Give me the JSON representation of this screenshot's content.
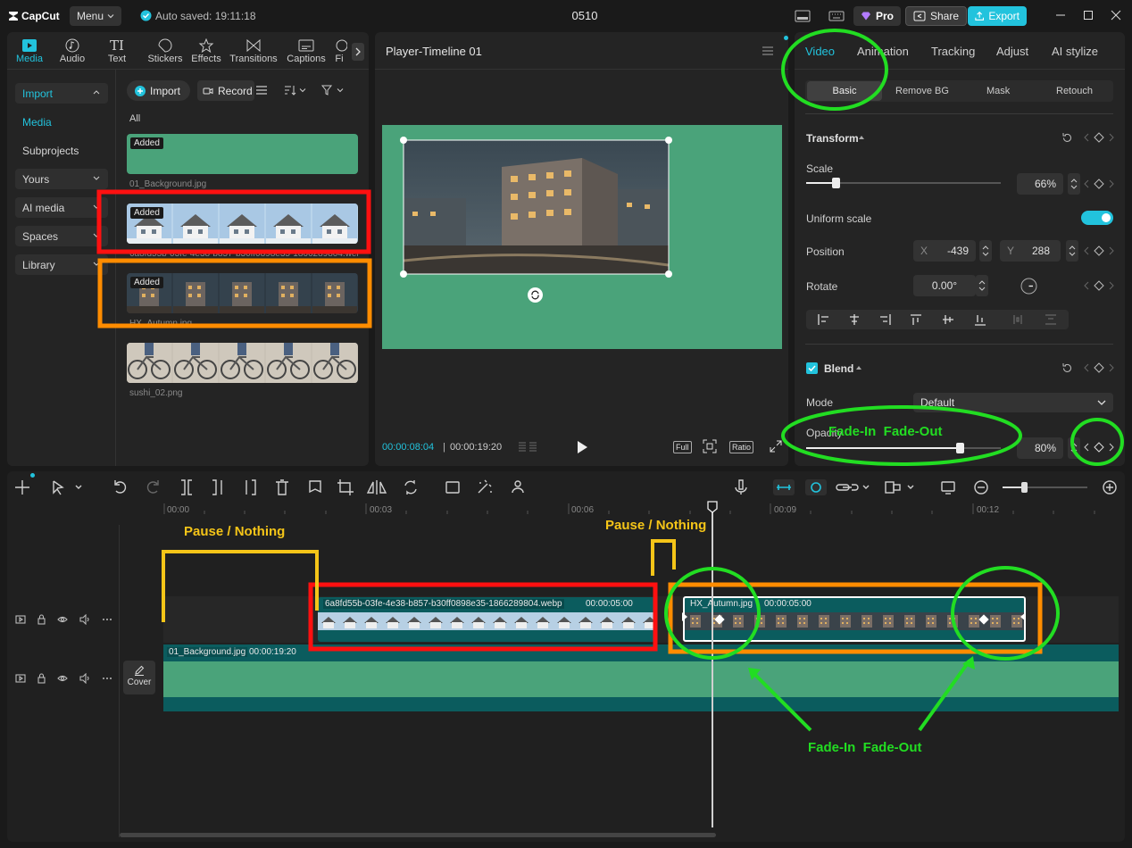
{
  "titlebar": {
    "logo": "CapCut",
    "menu_label": "Menu",
    "autosave": "Auto saved: 19:11:18",
    "project_name": "0510",
    "pro_label": "Pro",
    "share_label": "Share",
    "export_label": "Export"
  },
  "media_tabs": [
    {
      "label": "Media",
      "icon": "media-icon"
    },
    {
      "label": "Audio",
      "icon": "audio-icon"
    },
    {
      "label": "Text",
      "icon": "text-icon"
    },
    {
      "label": "Stickers",
      "icon": "stickers-icon"
    },
    {
      "label": "Effects",
      "icon": "effects-icon"
    },
    {
      "label": "Transitions",
      "icon": "transitions-icon"
    },
    {
      "label": "Captions",
      "icon": "captions-icon"
    },
    {
      "label": "Fi",
      "icon": "filters-icon"
    }
  ],
  "sidebar": {
    "import": "Import",
    "media": "Media",
    "subprojects": "Subprojects",
    "yours": "Yours",
    "ai_media": "AI media",
    "spaces": "Spaces",
    "library": "Library"
  },
  "media_toolbar": {
    "import_label": "Import",
    "record_label": "Record",
    "filter_all": "All"
  },
  "media_items": [
    {
      "badge": "Added",
      "name": "01_Background.jpg"
    },
    {
      "badge": "Added",
      "name": "6a8fd55b-03fe-4e38-b857-b30ff0898e35-1866289804.webp"
    },
    {
      "badge": "Added",
      "name": "HX_Autumn.jpg"
    },
    {
      "badge": "",
      "name": "sushi_02.png"
    }
  ],
  "player": {
    "title": "Player-Timeline 01",
    "current_time": "00:00:08:04",
    "total_time": "00:00:19:20",
    "full_label": "Full",
    "ratio_label": "Ratio"
  },
  "props": {
    "tabs": [
      "Video",
      "Animation",
      "Tracking",
      "Adjust",
      "AI stylize"
    ],
    "subtabs": [
      "Basic",
      "Remove BG",
      "Mask",
      "Retouch"
    ],
    "transform_label": "Transform",
    "scale_label": "Scale",
    "scale_value": "66%",
    "scale_fraction": 0.66,
    "uniform_label": "Uniform scale",
    "position_label": "Position",
    "pos_x_label": "X",
    "pos_x": "-439",
    "pos_y_label": "Y",
    "pos_y": "288",
    "rotate_label": "Rotate",
    "rotate_value": "0.00°",
    "blend_label": "Blend",
    "mode_label": "Mode",
    "mode_value": "Default",
    "opacity_label": "Opacity",
    "opacity_value": "80%",
    "opacity_fraction": 0.8
  },
  "timeline": {
    "ticks": [
      "00:00",
      "00:03",
      "00:06",
      "00:09",
      "00:12"
    ],
    "cover_label": "Cover",
    "clip_webp_name": "6a8fd55b-03fe-4e38-b857-b30ff0898e35-1866289804.webp",
    "clip_webp_dur": "00:00:05:00",
    "clip_autumn_name": "HX_Autumn.jpg",
    "clip_autumn_dur": "00:00:05:00",
    "clip_bg_name": "01_Background.jpg",
    "clip_bg_dur": "00:00:19:20"
  },
  "annotations": {
    "pause1": "Pause / Nothing",
    "pause2": "Pause / Nothing",
    "fade_top": "Fade-In  Fade-Out",
    "fade_bottom": "Fade-In  Fade-Out"
  },
  "colors": {
    "accent": "#22c3dd",
    "canvas_green": "#4aa37a",
    "clip_teal": "#0b5c5e",
    "annot_red": "#ff1010",
    "annot_orange": "#ff8c00",
    "annot_yellow": "#f5c518",
    "annot_green": "#22dd22"
  }
}
